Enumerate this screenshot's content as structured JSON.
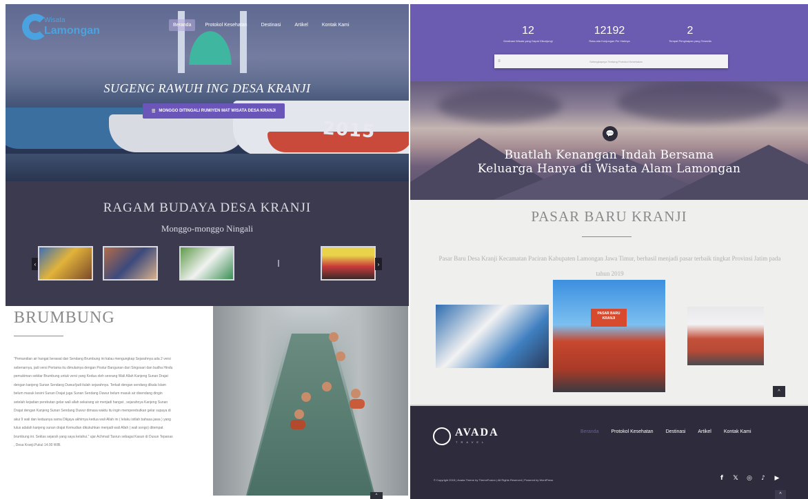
{
  "hero": {
    "logo_top": "Wisata",
    "logo_bottom": "Lamongan",
    "nav": [
      "Beranda",
      "Protokol Kesehatan",
      "Destinasi",
      "Artikel",
      "Kontak Kami"
    ],
    "headline": "SUGENG RAWUH ING DESA KRANJI",
    "cta_icon": "☰",
    "cta_label": "MONGGO DITINGALI RUMIYEN MAT WISATA DESA KRANJI",
    "boat_number": "2015"
  },
  "stats": {
    "items": [
      {
        "number": "12",
        "label": "Destinasi Wisata yang Dapat Dikunjungi"
      },
      {
        "number": "12192",
        "label": "Rata-rata Kunjungan Per Harinya"
      },
      {
        "number": "2",
        "label": "Tempat Penginapan yang Tersedia"
      }
    ],
    "bar_icon": "≡",
    "bar_label": "Selengkapnya Tentang Protokol Kesehatan"
  },
  "sunset": {
    "chat_icon": "💬",
    "line1": "Buatlah Kenangan Indah Bersama",
    "line2": "Keluarga Hanya di Wisata Alam Lamongan"
  },
  "ragam": {
    "title": "RAGAM BUDAYA DESA KRANJI",
    "subtitle": "Monggo-monggo Ningali",
    "prev_icon": "‹",
    "next_icon": "›"
  },
  "pasar": {
    "title": "PASAR BARU KRANJI",
    "description": "Pasar Baru Desa Kranji Kecamatan Paciran Kabupaten Lamongan Jawa Timur, berhasil menjadi pasar terbaik tingkat Provinsi Jatim pada tahun 2019",
    "sign_text": "PASAR BARU KRANJI",
    "up_icon": "^"
  },
  "brumbung": {
    "title": "BRUMBUNG",
    "body": "\"Pemandian air hangat berawal dari Sendang Brumbung ini kalau mengungkap Sejarahnya ada 2 versi sebenarnya, jadi versi Pertama itu dimulainya dengan Postur Bangunan dari Singosari dan budha Hindu pemukiman sekitar Brumbung untuk versi yang Kedua oleh seorang Wali Allah Kanjeng Sunan Drajat dengan kanjeng Sunan Sendang Duwur/jadi itulah sejarahnya. Terkait dengan sendang dikala Islam belum masuk kesini Sunan Drajat juga Sunan Sendang Duwur belum masuk air disendang dingin setelah kejadian perebutan gelar wali allah sekarang air menjadi hangat , sejarahnya Kanjeng Sunan Drajat dengan Kanjeng Sunan Sendang Duwur dimasa waktu itu ingin memperebutkan gelar supaya di akui 9 wali dan keduanya sama Dikjaya akhirnya kedua wali Allah ini ( lelaku istilah bahasa jawa ) yang lulus adalah kanjeng sunan drajat Kemudian dikukuhkan menjadi wali Allah ( wali songo) ditempat brumbung ini. Seklas sejarah yang saya ketahui.\" ujar Achmad Tasrun sebagai Kasun di Dusun Tepanas , Desa Kranji.Pukul 14.00 WIB.",
    "up_icon": "^"
  },
  "footer": {
    "logo_text": "AVADA",
    "logo_sub": "TRAVEL",
    "nav": [
      "Beranda",
      "Protokol Kesehatan",
      "Destinasi",
      "Artikel",
      "Kontak Kami"
    ],
    "copyright": "© Copyright 2015 | Avada Theme by ThemeFusion | All Rights Reserved | Powered by WordPress",
    "socials": [
      "f",
      "𝕏",
      "◎",
      "♪",
      "▶"
    ],
    "up_icon": "^"
  },
  "colors": {
    "purple": "#6b5bb1",
    "dark": "#3b3a4e",
    "footer": "#2e2c3c"
  }
}
